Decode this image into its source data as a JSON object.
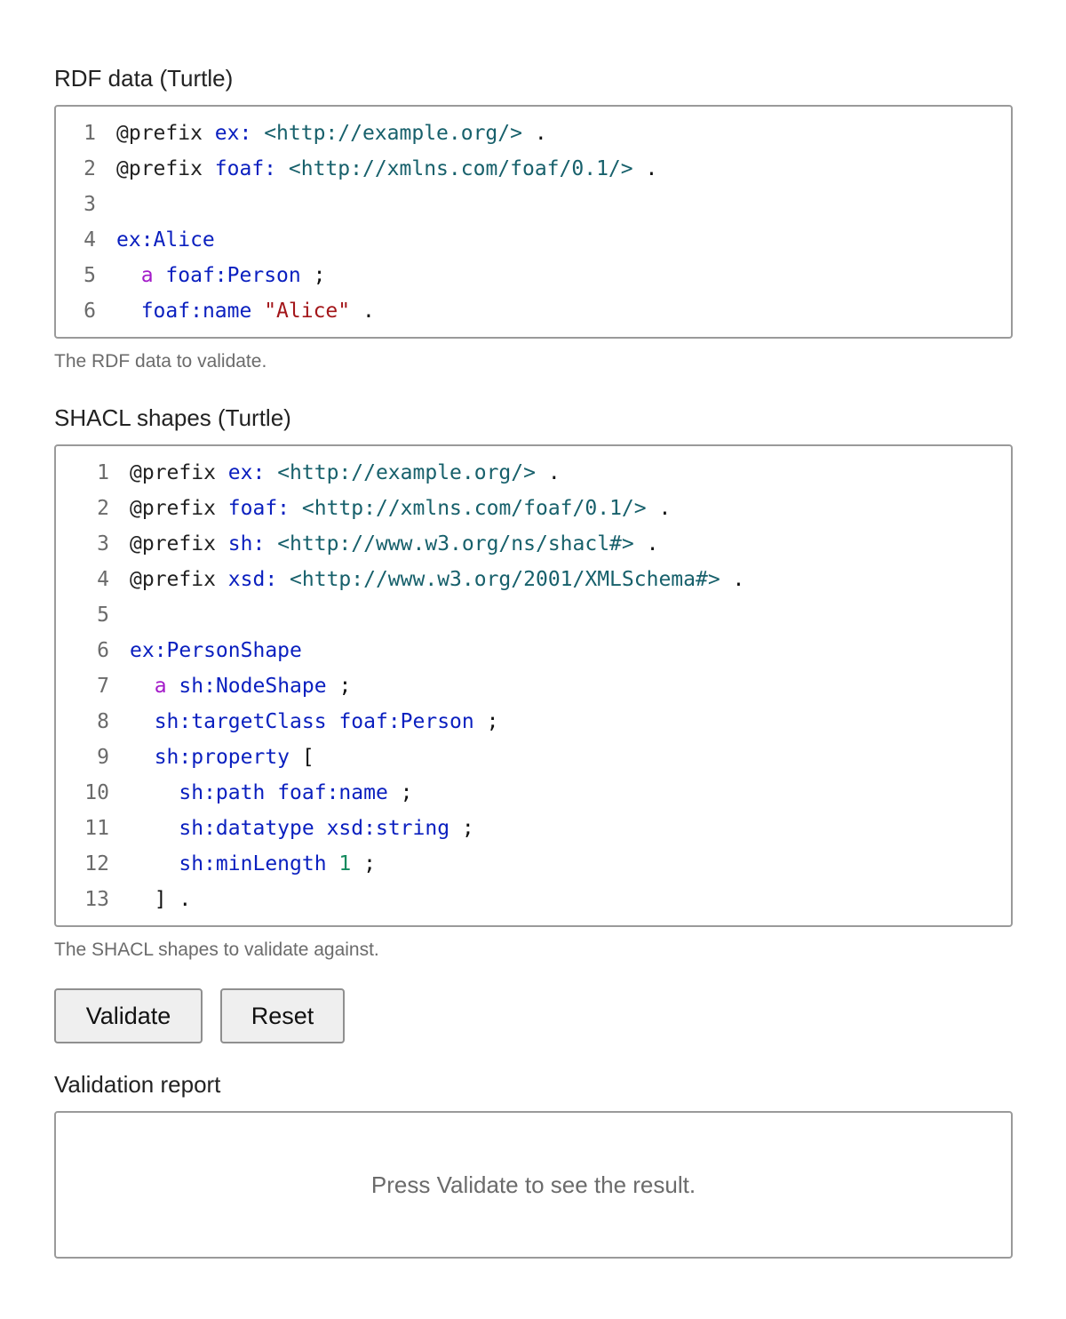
{
  "rdf_section": {
    "label": "RDF data (Turtle)",
    "help": "The RDF data to validate.",
    "lines": [
      [
        {
          "t": "@prefix ",
          "c": "kw"
        },
        {
          "t": "ex:",
          "c": "prefix"
        },
        {
          "t": " ",
          "c": "plain"
        },
        {
          "t": "<http://example.org/>",
          "c": "iri"
        },
        {
          "t": " .",
          "c": "punct"
        }
      ],
      [
        {
          "t": "@prefix ",
          "c": "kw"
        },
        {
          "t": "foaf:",
          "c": "prefix"
        },
        {
          "t": " ",
          "c": "plain"
        },
        {
          "t": "<http://xmlns.com/foaf/0.1/>",
          "c": "iri"
        },
        {
          "t": " .",
          "c": "punct"
        }
      ],
      [],
      [
        {
          "t": "ex:Alice",
          "c": "prefix"
        }
      ],
      [
        {
          "t": "  ",
          "c": "plain"
        },
        {
          "t": "a",
          "c": "a"
        },
        {
          "t": " ",
          "c": "plain"
        },
        {
          "t": "foaf:Person",
          "c": "prefix"
        },
        {
          "t": " ;",
          "c": "punct"
        }
      ],
      [
        {
          "t": "  ",
          "c": "plain"
        },
        {
          "t": "foaf:name",
          "c": "prefix"
        },
        {
          "t": " ",
          "c": "plain"
        },
        {
          "t": "\"Alice\"",
          "c": "str"
        },
        {
          "t": " .",
          "c": "punct"
        }
      ]
    ]
  },
  "shacl_section": {
    "label": "SHACL shapes (Turtle)",
    "help": "The SHACL shapes to validate against.",
    "lines": [
      [
        {
          "t": "@prefix ",
          "c": "kw"
        },
        {
          "t": "ex:",
          "c": "prefix"
        },
        {
          "t": " ",
          "c": "plain"
        },
        {
          "t": "<http://example.org/>",
          "c": "iri"
        },
        {
          "t": " .",
          "c": "punct"
        }
      ],
      [
        {
          "t": "@prefix ",
          "c": "kw"
        },
        {
          "t": "foaf:",
          "c": "prefix"
        },
        {
          "t": " ",
          "c": "plain"
        },
        {
          "t": "<http://xmlns.com/foaf/0.1/>",
          "c": "iri"
        },
        {
          "t": " .",
          "c": "punct"
        }
      ],
      [
        {
          "t": "@prefix ",
          "c": "kw"
        },
        {
          "t": "sh:",
          "c": "prefix"
        },
        {
          "t": " ",
          "c": "plain"
        },
        {
          "t": "<http://www.w3.org/ns/shacl#>",
          "c": "iri"
        },
        {
          "t": " .",
          "c": "punct"
        }
      ],
      [
        {
          "t": "@prefix ",
          "c": "kw"
        },
        {
          "t": "xsd:",
          "c": "prefix"
        },
        {
          "t": " ",
          "c": "plain"
        },
        {
          "t": "<http://www.w3.org/2001/XMLSchema#>",
          "c": "iri"
        },
        {
          "t": " .",
          "c": "punct"
        }
      ],
      [],
      [
        {
          "t": "ex:PersonShape",
          "c": "prefix"
        }
      ],
      [
        {
          "t": "  ",
          "c": "plain"
        },
        {
          "t": "a",
          "c": "a"
        },
        {
          "t": " ",
          "c": "plain"
        },
        {
          "t": "sh:NodeShape",
          "c": "prefix"
        },
        {
          "t": " ;",
          "c": "punct"
        }
      ],
      [
        {
          "t": "  ",
          "c": "plain"
        },
        {
          "t": "sh:targetClass",
          "c": "prefix"
        },
        {
          "t": " ",
          "c": "plain"
        },
        {
          "t": "foaf:Person",
          "c": "prefix"
        },
        {
          "t": " ;",
          "c": "punct"
        }
      ],
      [
        {
          "t": "  ",
          "c": "plain"
        },
        {
          "t": "sh:property",
          "c": "prefix"
        },
        {
          "t": " [",
          "c": "punct"
        }
      ],
      [
        {
          "t": "    ",
          "c": "plain"
        },
        {
          "t": "sh:path",
          "c": "prefix"
        },
        {
          "t": " ",
          "c": "plain"
        },
        {
          "t": "foaf:name",
          "c": "prefix"
        },
        {
          "t": " ;",
          "c": "punct"
        }
      ],
      [
        {
          "t": "    ",
          "c": "plain"
        },
        {
          "t": "sh:datatype",
          "c": "prefix"
        },
        {
          "t": " ",
          "c": "plain"
        },
        {
          "t": "xsd:string",
          "c": "prefix"
        },
        {
          "t": " ;",
          "c": "punct"
        }
      ],
      [
        {
          "t": "    ",
          "c": "plain"
        },
        {
          "t": "sh:minLength",
          "c": "prefix"
        },
        {
          "t": " ",
          "c": "plain"
        },
        {
          "t": "1",
          "c": "num"
        },
        {
          "t": " ;",
          "c": "punct"
        }
      ],
      [
        {
          "t": "  ] .",
          "c": "punct"
        }
      ]
    ]
  },
  "buttons": {
    "validate_label": "Validate",
    "reset_label": "Reset"
  },
  "report_section": {
    "label": "Validation report",
    "placeholder": "Press Validate to see the result."
  }
}
